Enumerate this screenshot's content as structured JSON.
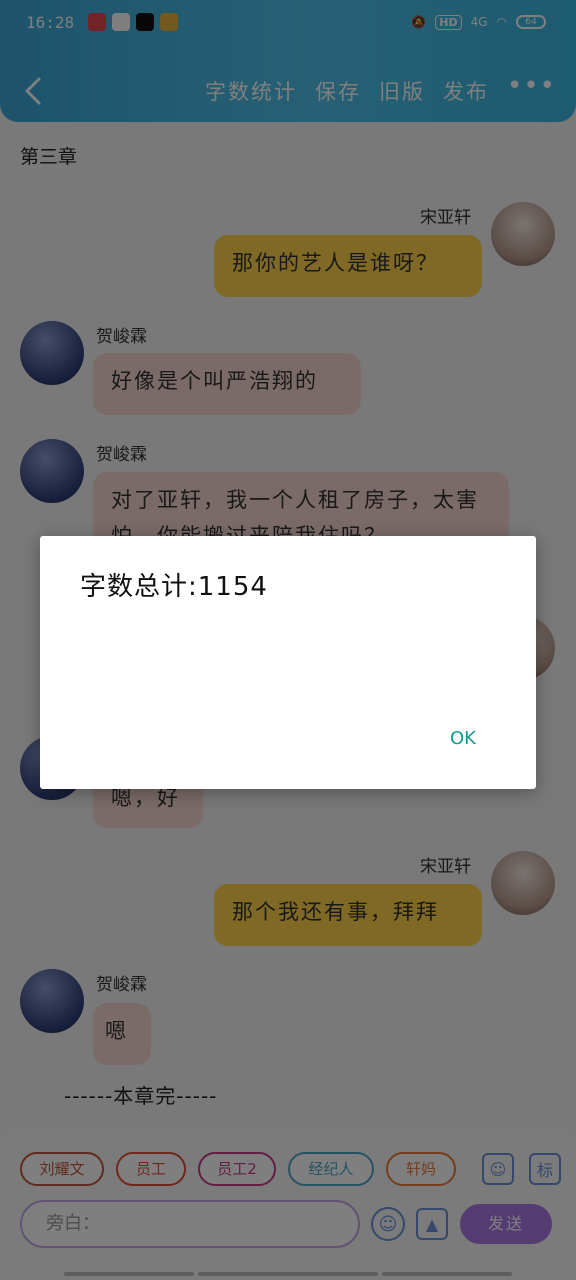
{
  "status": {
    "time": "16:28",
    "network": "4G",
    "hd": "HD",
    "battery": "64"
  },
  "appbar": {
    "actions": [
      "字数统计",
      "保存",
      "旧版",
      "发布"
    ]
  },
  "chapter": {
    "title": "第三章",
    "end_marker": "------本章完-----"
  },
  "messages": [
    {
      "sender": "宋亚轩",
      "side": "right",
      "text": "那你的艺人是谁呀？"
    },
    {
      "sender": "贺峻霖",
      "side": "left",
      "text": "好像是个叫严浩翔的"
    },
    {
      "sender": "贺峻霖",
      "side": "left",
      "text": "对了亚轩，我一个人租了房子，太害怕，你能搬过来陪我住吗？"
    },
    {
      "sender": "",
      "side": "left",
      "text": "嗯，好"
    },
    {
      "sender": "宋亚轩",
      "side": "right",
      "text": "那个我还有事，拜拜"
    },
    {
      "sender": "贺峻霖",
      "side": "left",
      "text": "嗯"
    }
  ],
  "composer": {
    "roles": [
      {
        "label": "刘耀文",
        "color": "#c0563c"
      },
      {
        "label": "员工",
        "color": "#e0503a"
      },
      {
        "label": "员工2",
        "color": "#c63a8e"
      },
      {
        "label": "经纪人",
        "color": "#4aa6c8"
      },
      {
        "label": "轩妈",
        "color": "#e87a3a"
      }
    ],
    "input_placeholder": "旁白：",
    "send_label": "发送"
  },
  "dialog": {
    "message": "字数总计:1154",
    "ok_label": "OK"
  }
}
